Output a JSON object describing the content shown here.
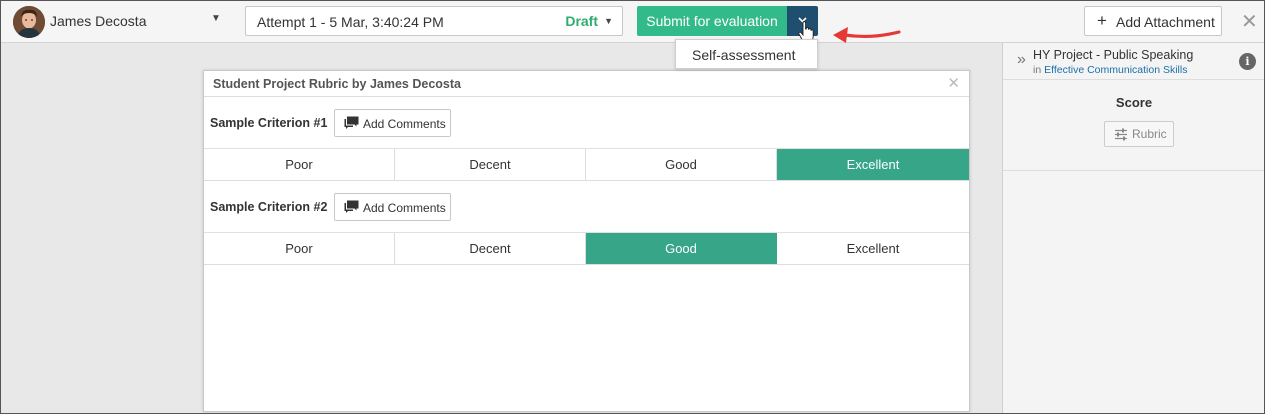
{
  "header": {
    "user_name": "James Decosta",
    "attempt_label": "Attempt 1 - 5 Mar, 3:40:24 PM",
    "attempt_status": "Draft",
    "submit_label": "Submit for evaluation",
    "submit_menu": [
      "Self-assessment"
    ],
    "add_attachment_label": "Add Attachment"
  },
  "right_panel": {
    "title": "HY Project - Public Speaking",
    "subtitle_prefix": "in",
    "subtitle_course": "Effective Communication Skills",
    "score_label": "Score",
    "rubric_button": "Rubric"
  },
  "rubric": {
    "title": "Student Project Rubric by James Decosta",
    "criteria": [
      {
        "name": "Sample Criterion #1",
        "comments_label": "Add Comments",
        "levels": [
          "Poor",
          "Decent",
          "Good",
          "Excellent"
        ],
        "selected": "Excellent"
      },
      {
        "name": "Sample Criterion #2",
        "comments_label": "Add Comments",
        "levels": [
          "Poor",
          "Decent",
          "Good",
          "Excellent"
        ],
        "selected": "Good"
      }
    ]
  },
  "colors": {
    "submit_green": "#33ba8a",
    "toggle_navy": "#1f4e6e",
    "selected_level": "#36a588",
    "draft_green": "#2ead6e",
    "arrow_red": "#e53935"
  },
  "icons": {
    "avatar": "user-avatar",
    "user_caret": "caret-down-icon",
    "toggle": "chevron-down-icon",
    "cursor": "hand-pointer-icon",
    "annotation": "red-arrow-icon",
    "add": "plus-icon",
    "close": "close-icon",
    "expand": "double-chevron-right-icon",
    "info": "info-icon",
    "rubric": "sliders-icon",
    "comments": "speech-bubble-icon"
  }
}
